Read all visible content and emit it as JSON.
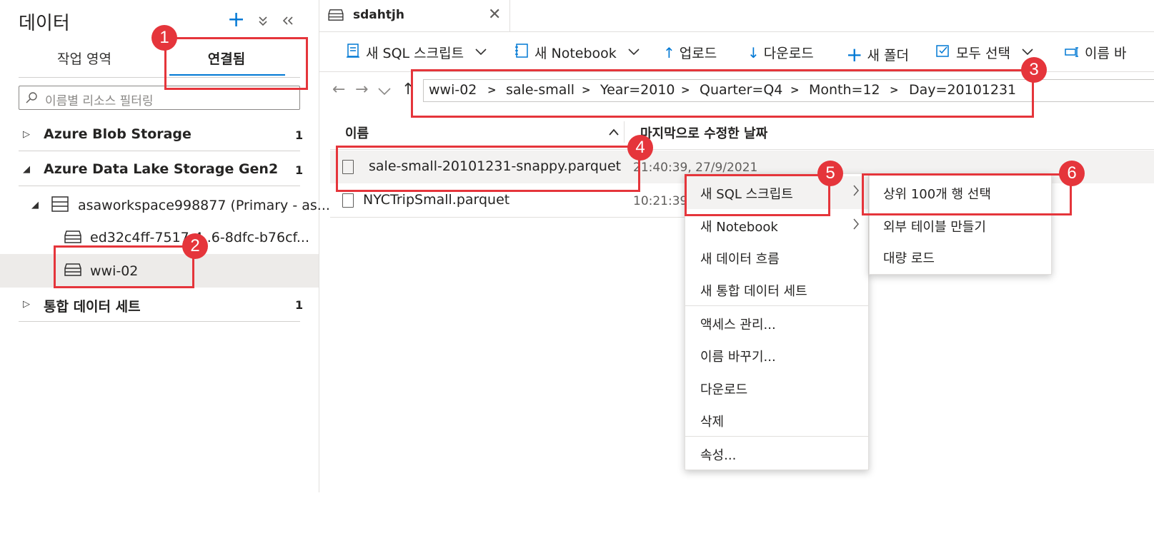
{
  "left_panel": {
    "title": "데이터",
    "tabs": [
      "작업 영역",
      "연결됨"
    ],
    "filter_placeholder": "이름별 리소스 필터링",
    "tree": {
      "azure_blob": {
        "label": "Azure Blob Storage",
        "count": "1"
      },
      "adls_gen2": {
        "label": "Azure Data Lake Storage Gen2",
        "count": "1"
      },
      "workspace": {
        "label": "asaworkspace998877 (Primary - as..."
      },
      "container1": {
        "label": "ed32c4ff-7517-4..6-8dfc-b76cf..."
      },
      "container2": {
        "label": "wwi-02"
      },
      "integration": {
        "label": "통합 데이터 세트",
        "count": "1"
      }
    }
  },
  "doc_tab": {
    "label": "sdahtjh"
  },
  "toolbar": {
    "new_sql": "새 SQL 스크립트",
    "new_notebook": "새 Notebook",
    "upload": "업로드",
    "download": "다운로드",
    "new_folder": "새 폴더",
    "select_all": "모두 선택",
    "rename": "이름 바"
  },
  "breadcrumb": [
    "wwi-02",
    "sale-small",
    "Year=2010",
    "Quarter=Q4",
    "Month=12",
    "Day=20101231"
  ],
  "file_list": {
    "col_name": "이름",
    "col_modified": "마지막으로 수정한 날짜",
    "rows": [
      {
        "name": "sale-small-20101231-snappy.parquet",
        "date": "21:40:39, 27/9/2021"
      },
      {
        "name": "NYCTripSmall.parquet",
        "date": "10:21:39"
      }
    ]
  },
  "context_menu": {
    "items": [
      "새 SQL 스크립트",
      "새 Notebook",
      "새 데이터 흐름",
      "새 통합 데이터 세트",
      "액세스 관리...",
      "이름 바꾸기...",
      "다운로드",
      "삭제",
      "속성..."
    ]
  },
  "submenu": {
    "items": [
      "상위 100개 행 선택",
      "외부 테이블 만들기",
      "대량 로드"
    ]
  },
  "callouts": [
    "1",
    "2",
    "3",
    "4",
    "5",
    "6"
  ],
  "colors": {
    "accent": "#0078d4",
    "callout": "#e5353b",
    "selection": "#edebe9"
  }
}
